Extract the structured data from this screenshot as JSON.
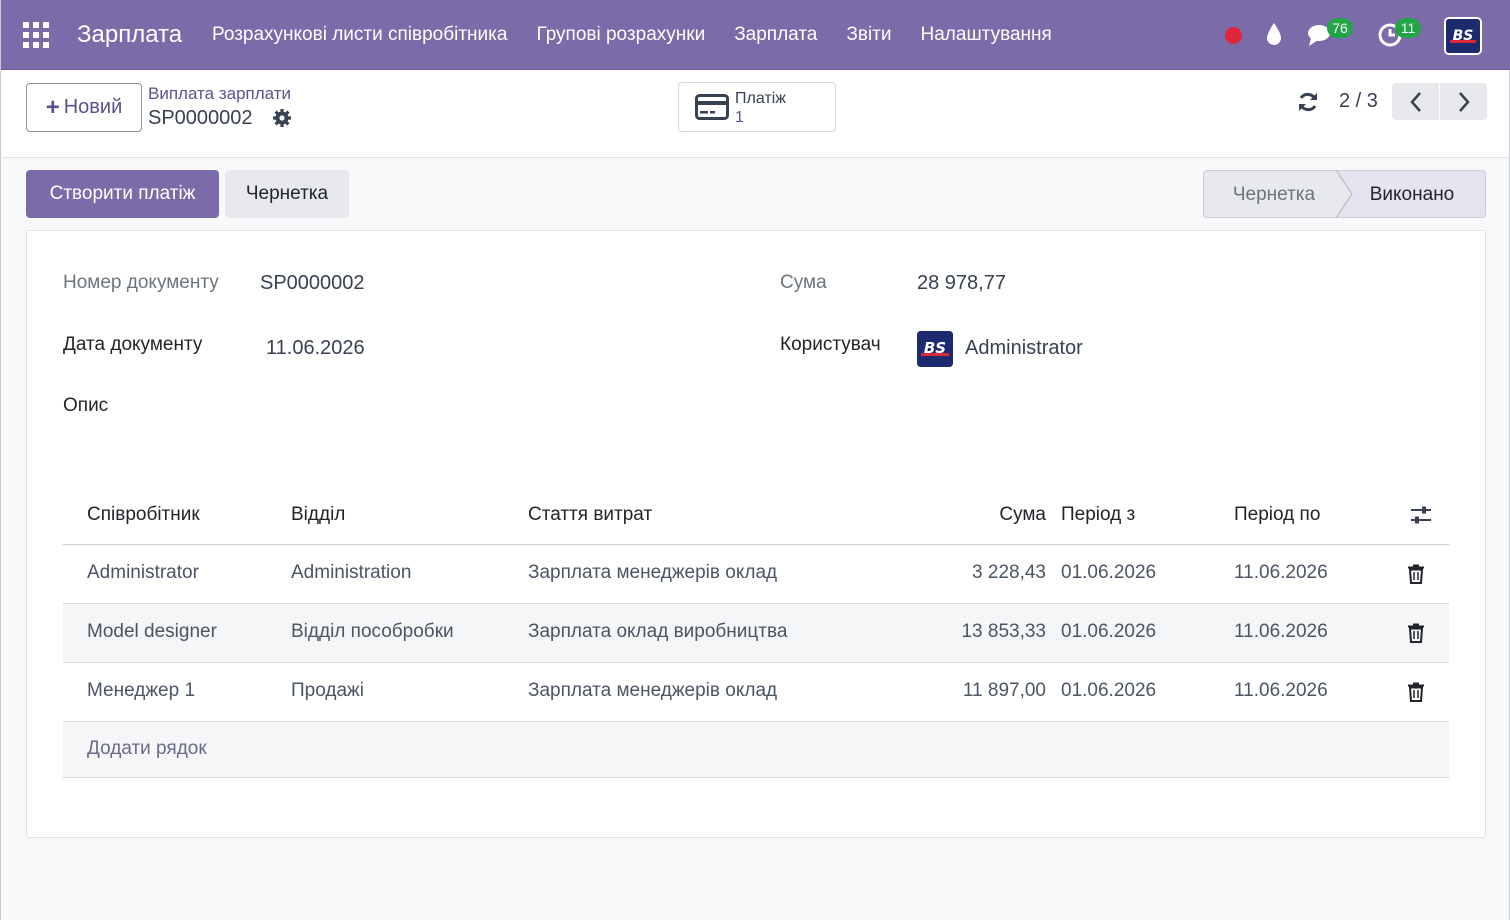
{
  "navbar": {
    "brand": "Зарплата",
    "menu": [
      "Розрахункові листи співробітника",
      "Групові розрахунки",
      "Зарплата",
      "Звіти",
      "Налаштування"
    ],
    "messages_count": "76",
    "activities_count": "11",
    "logo_text": "BS"
  },
  "control": {
    "new_button": "Новий",
    "breadcrumb_parent": "Виплата зарплати",
    "breadcrumb_current": "SP0000002",
    "smart_button_label": "Платіж",
    "smart_button_value": "1",
    "pager": "2 / 3"
  },
  "statusbar": {
    "primary_action": "Створити платіж",
    "secondary_action": "Чернетка",
    "stages": [
      "Чернетка",
      "Виконано"
    ],
    "current_stage": "Виконано"
  },
  "form": {
    "doc_number_label": "Номер документу",
    "doc_number": "SP0000002",
    "doc_date_label": "Дата документу",
    "doc_date": "11.06.2026",
    "description_label": "Опис",
    "amount_label": "Сума",
    "amount": "28 978,77",
    "user_label": "Користувач",
    "user": "Administrator"
  },
  "table": {
    "headers": [
      "Співробітник",
      "Відділ",
      "Стаття витрат",
      "Сума",
      "Період з",
      "Період по"
    ],
    "rows": [
      [
        "Administrator",
        "Administration",
        "Зарплата менеджерів оклад",
        "3 228,43",
        "01.06.2026",
        "11.06.2026"
      ],
      [
        "Model designer",
        "Відділ пособробки",
        "Зарплата оклад виробництва",
        "13 853,33",
        "01.06.2026",
        "11.06.2026"
      ],
      [
        "Менеджер 1",
        "Продажі",
        "Зарплата менеджерів оклад",
        "11 897,00",
        "01.06.2026",
        "11.06.2026"
      ]
    ],
    "add_line": "Додати рядок"
  },
  "colors": {
    "navbar": "#7c6ba9",
    "primary": "#7c6ba9",
    "badge": "#22a447",
    "record_dot": "#e0263d"
  }
}
